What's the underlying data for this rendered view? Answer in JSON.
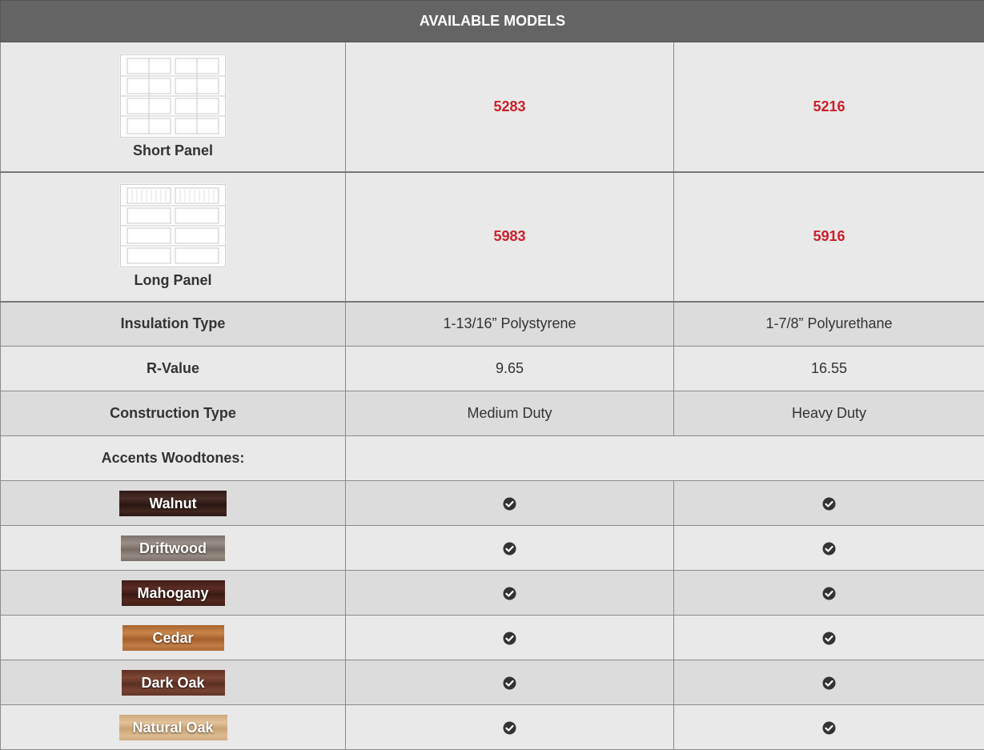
{
  "table": {
    "header": "AVAILABLE MODELS",
    "panels": [
      {
        "label": "Short Panel",
        "models": [
          "5283",
          "5216"
        ]
      },
      {
        "label": "Long Panel",
        "models": [
          "5983",
          "5916"
        ]
      }
    ],
    "specs": [
      {
        "label": "Insulation Type",
        "values": [
          "1-13/16” Polystyrene",
          "1-7/8” Polyurethane"
        ]
      },
      {
        "label": "R-Value",
        "values": [
          "9.65",
          "16.55"
        ]
      },
      {
        "label": "Construction Type",
        "values": [
          "Medium Duty",
          "Heavy Duty"
        ]
      }
    ],
    "accents_label": "Accents Woodtones:",
    "woodtones": [
      {
        "name": "Walnut",
        "color": "#3b2320"
      },
      {
        "name": "Driftwood",
        "color": "#8a8078"
      },
      {
        "name": "Mahogany",
        "color": "#4a231c"
      },
      {
        "name": "Cedar",
        "color": "#b9733b"
      },
      {
        "name": "Dark Oak",
        "color": "#6e3b2b"
      },
      {
        "name": "Natural Oak",
        "color": "#d8b48a"
      }
    ],
    "availability_icon": "check-circle-icon"
  }
}
